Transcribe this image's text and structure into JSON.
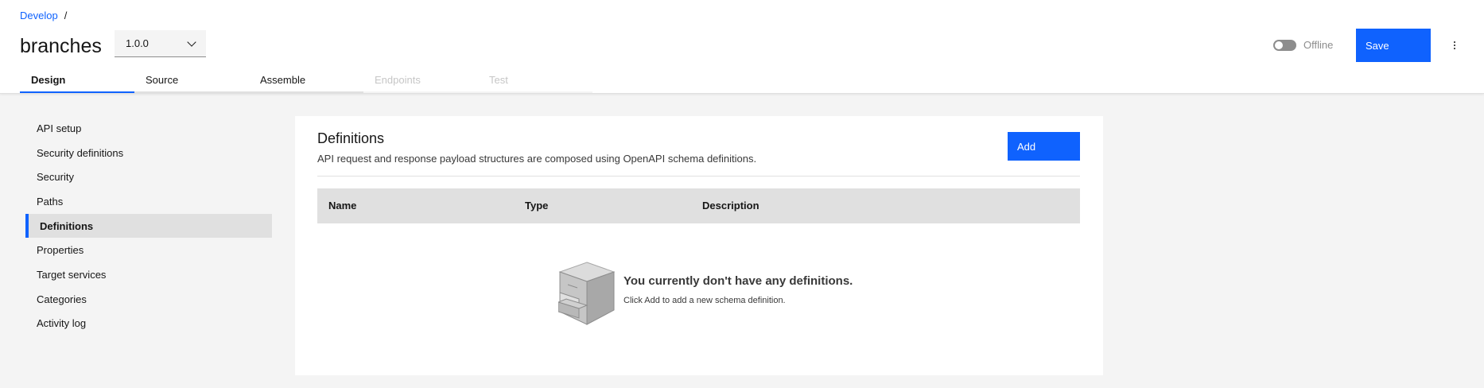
{
  "breadcrumb": {
    "link": "Develop",
    "separator": "/"
  },
  "title": "branches",
  "version": "1.0.0",
  "status": {
    "label": "Offline"
  },
  "actions": {
    "save_label": "Save"
  },
  "tabs": [
    {
      "label": "Design",
      "state": "active"
    },
    {
      "label": "Source",
      "state": "normal"
    },
    {
      "label": "Assemble",
      "state": "normal"
    },
    {
      "label": "Endpoints",
      "state": "disabled"
    },
    {
      "label": "Test",
      "state": "disabled"
    }
  ],
  "sidebar": {
    "items": [
      {
        "label": "API setup"
      },
      {
        "label": "Security definitions"
      },
      {
        "label": "Security"
      },
      {
        "label": "Paths"
      },
      {
        "label": "Definitions",
        "active": true
      },
      {
        "label": "Properties"
      },
      {
        "label": "Target services"
      },
      {
        "label": "Categories"
      },
      {
        "label": "Activity log"
      }
    ]
  },
  "panel": {
    "title": "Definitions",
    "description": "API request and response payload structures are composed using OpenAPI schema definitions.",
    "add_label": "Add",
    "columns": [
      "Name",
      "Type",
      "Description"
    ],
    "empty": {
      "icon": "filing-cabinet-icon",
      "title": "You currently don't have any definitions.",
      "subtitle": "Click Add to add a new schema definition."
    }
  },
  "colors": {
    "accent": "#0f62fe",
    "background": "#f4f4f4",
    "header_fill": "#e0e0e0"
  }
}
